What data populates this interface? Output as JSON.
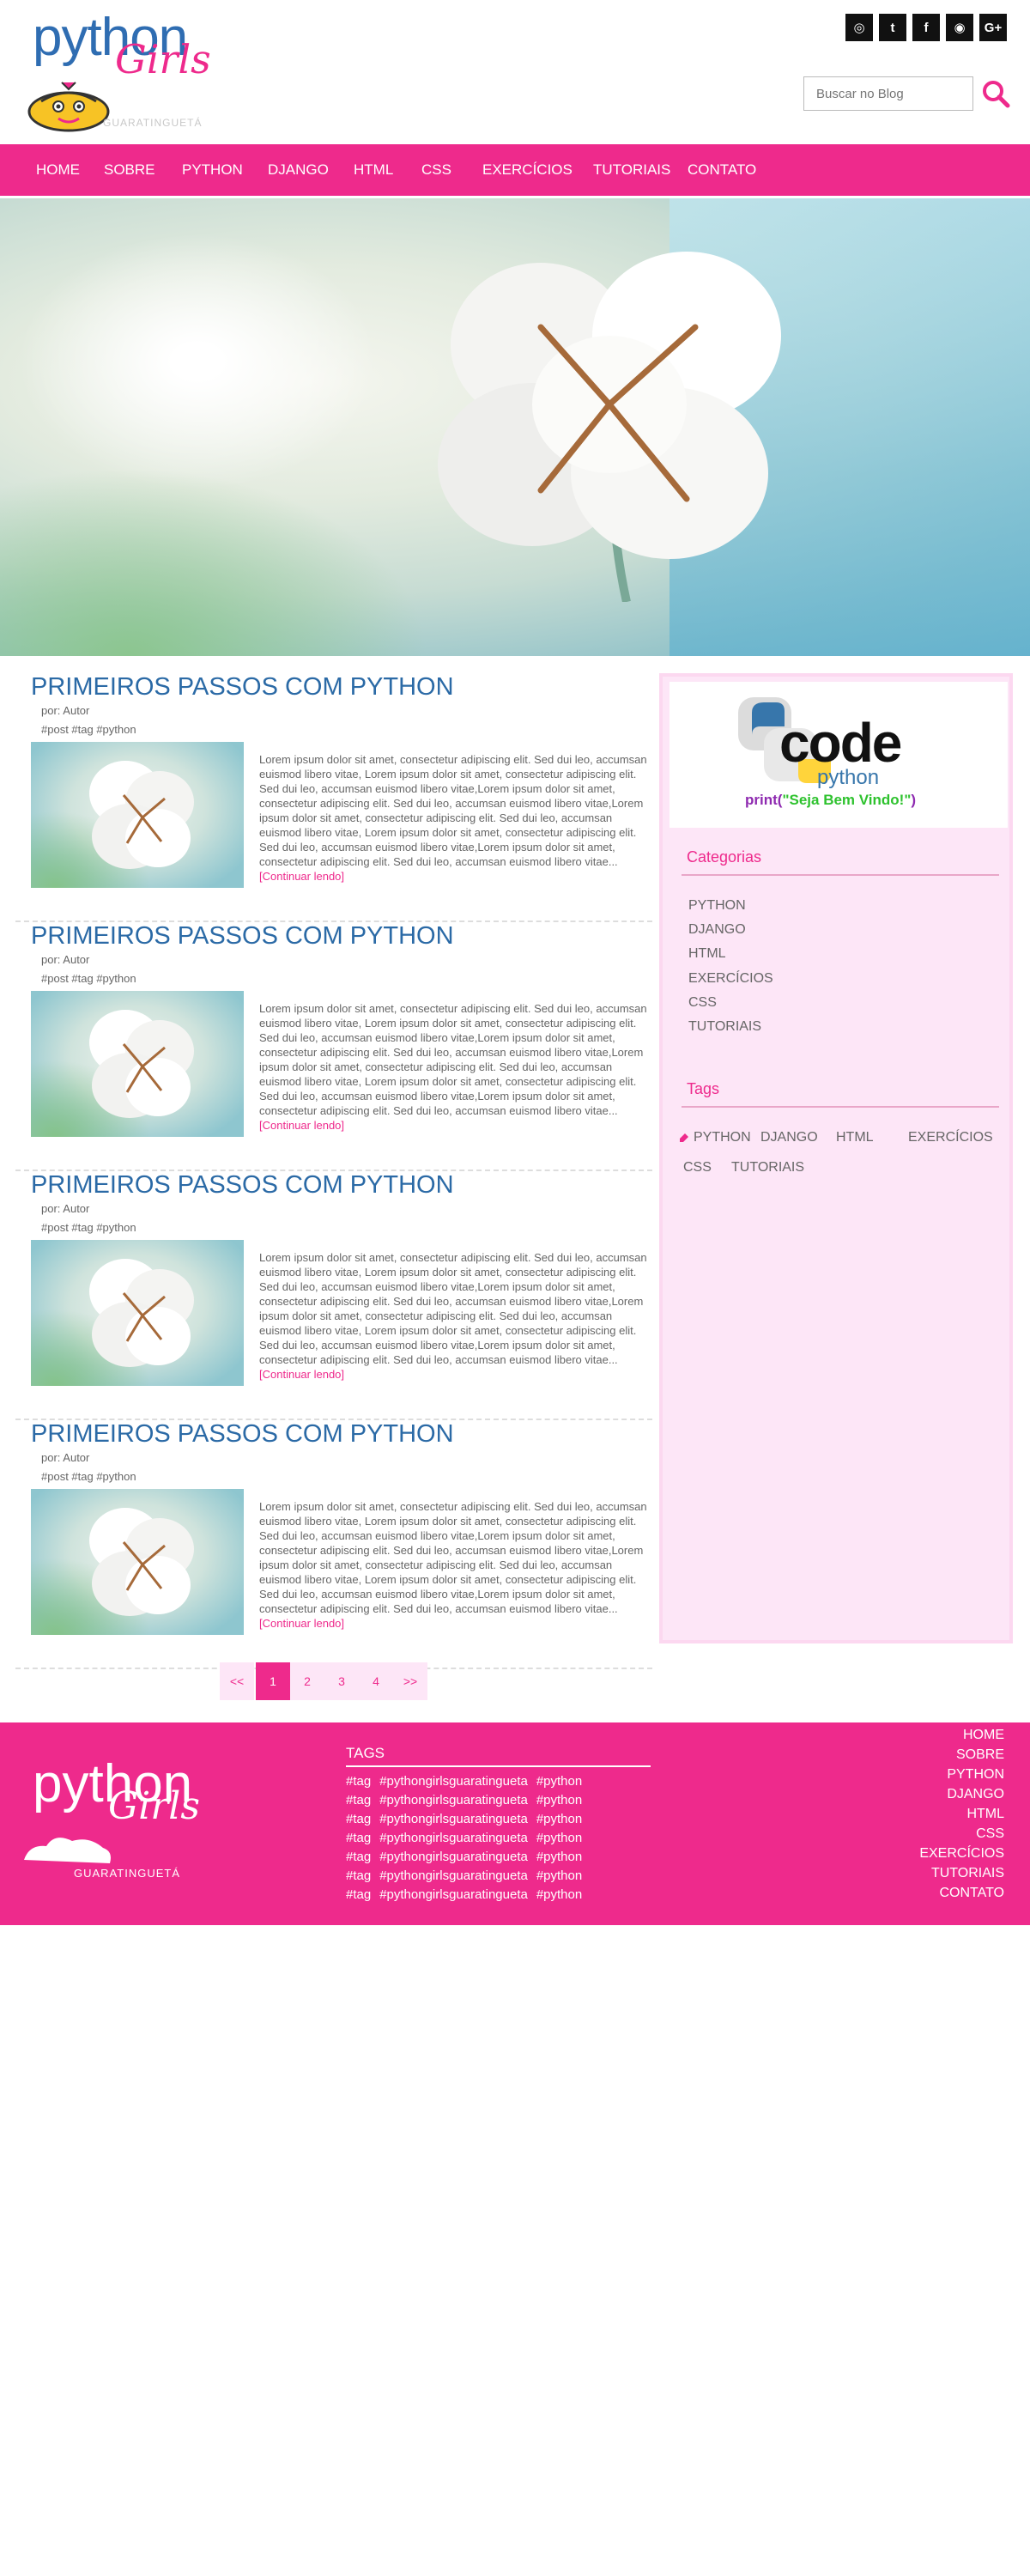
{
  "brand": {
    "logo_top": "python",
    "logo_script": "Girls",
    "logo_sub": "GUARATINGUETÁ"
  },
  "social": [
    {
      "icon": "instagram-icon",
      "glyph": "◎"
    },
    {
      "icon": "twitter-icon",
      "glyph": "t"
    },
    {
      "icon": "facebook-icon",
      "glyph": "f"
    },
    {
      "icon": "github-icon",
      "glyph": "◉"
    },
    {
      "icon": "google-plus-icon",
      "glyph": "G+"
    }
  ],
  "search": {
    "placeholder": "Buscar no Blog"
  },
  "nav": [
    "HOME",
    "SOBRE",
    "PYTHON",
    "DJANGO",
    "HTML",
    "CSS",
    "EXERCÍCIOS",
    "TUTORIAIS",
    "CONTATO"
  ],
  "posts": [
    {
      "title": "PRIMEIROS PASSOS COM PYTHON",
      "author": "por: Autor",
      "tags": "#post #tag #python",
      "excerpt": "Lorem ipsum dolor sit amet, consectetur adipiscing elit. Sed dui leo, accumsan euismod libero vitae, Lorem ipsum dolor sit amet, consectetur adipiscing elit. Sed dui leo, accumsan euismod libero vitae,Lorem ipsum dolor sit amet, consectetur adipiscing elit. Sed dui leo, accumsan euismod libero vitae,Lorem ipsum dolor sit amet, consectetur adipiscing elit. Sed dui leo, accumsan euismod libero vitae, Lorem ipsum dolor sit amet, consectetur adipiscing elit. Sed dui leo, accumsan euismod libero vitae,Lorem ipsum dolor sit amet, consectetur adipiscing elit. Sed dui leo, accumsan euismod libero vitae...",
      "more": "[Continuar lendo]"
    },
    {
      "title": "PRIMEIROS PASSOS COM PYTHON",
      "author": "por: Autor",
      "tags": "#post #tag #python",
      "excerpt": "Lorem ipsum dolor sit amet, consectetur adipiscing elit. Sed dui leo, accumsan euismod libero vitae, Lorem ipsum dolor sit amet, consectetur adipiscing elit. Sed dui leo, accumsan euismod libero vitae,Lorem ipsum dolor sit amet, consectetur adipiscing elit. Sed dui leo, accumsan euismod libero vitae,Lorem ipsum dolor sit amet, consectetur adipiscing elit. Sed dui leo, accumsan euismod libero vitae, Lorem ipsum dolor sit amet, consectetur adipiscing elit. Sed dui leo, accumsan euismod libero vitae,Lorem ipsum dolor sit amet, consectetur adipiscing elit. Sed dui leo, accumsan euismod libero vitae...",
      "more": "[Continuar lendo]"
    },
    {
      "title": "PRIMEIROS PASSOS COM PYTHON",
      "author": "por: Autor",
      "tags": "#post #tag #python",
      "excerpt": "Lorem ipsum dolor sit amet, consectetur adipiscing elit. Sed dui leo, accumsan euismod libero vitae, Lorem ipsum dolor sit amet, consectetur adipiscing elit. Sed dui leo, accumsan euismod libero vitae,Lorem ipsum dolor sit amet, consectetur adipiscing elit. Sed dui leo, accumsan euismod libero vitae,Lorem ipsum dolor sit amet, consectetur adipiscing elit. Sed dui leo, accumsan euismod libero vitae, Lorem ipsum dolor sit amet, consectetur adipiscing elit. Sed dui leo, accumsan euismod libero vitae,Lorem ipsum dolor sit amet, consectetur adipiscing elit. Sed dui leo, accumsan euismod libero vitae...",
      "more": "[Continuar lendo]"
    },
    {
      "title": "PRIMEIROS PASSOS COM PYTHON",
      "author": "por: Autor",
      "tags": "#post #tag #python",
      "excerpt": "Lorem ipsum dolor sit amet, consectetur adipiscing elit. Sed dui leo, accumsan euismod libero vitae, Lorem ipsum dolor sit amet, consectetur adipiscing elit. Sed dui leo, accumsan euismod libero vitae,Lorem ipsum dolor sit amet, consectetur adipiscing elit. Sed dui leo, accumsan euismod libero vitae,Lorem ipsum dolor sit amet, consectetur adipiscing elit. Sed dui leo, accumsan euismod libero vitae, Lorem ipsum dolor sit amet, consectetur adipiscing elit. Sed dui leo, accumsan euismod libero vitae,Lorem ipsum dolor sit amet, consectetur adipiscing elit. Sed dui leo, accumsan euismod libero vitae...",
      "more": "[Continuar lendo]"
    }
  ],
  "sidebar": {
    "code_word": "code",
    "code_python": "python",
    "code_print": "print(",
    "code_string": "\"Seja Bem Vindo!\"",
    "code_close": ")",
    "categories_title": "Categorias",
    "categories": [
      "PYTHON",
      "DJANGO",
      "HTML",
      "EXERCÍCIOS",
      "CSS",
      "TUTORIAIS"
    ],
    "tags_title": "Tags",
    "tags": [
      "PYTHON",
      "DJANGO",
      "HTML",
      "EXERCÍCIOS",
      "CSS",
      "TUTORIAIS"
    ]
  },
  "pagination": [
    "<<",
    "1",
    "2",
    "3",
    "4",
    ">>"
  ],
  "footer": {
    "logo_top": "python",
    "logo_script": "Girls",
    "logo_sub": "GUARATINGUETÁ",
    "tags_title": "TAGS",
    "tag_rows": [
      [
        "#tag",
        "#pythongirlsguaratingueta",
        "#python"
      ],
      [
        "#tag",
        "#pythongirlsguaratingueta",
        "#python"
      ],
      [
        "#tag",
        "#pythongirlsguaratingueta",
        "#python"
      ],
      [
        "#tag",
        "#pythongirlsguaratingueta",
        "#python"
      ],
      [
        "#tag",
        "#pythongirlsguaratingueta",
        "#python"
      ],
      [
        "#tag",
        "#pythongirlsguaratingueta",
        "#python"
      ],
      [
        "#tag",
        "#pythongirlsguaratingueta",
        "#python"
      ]
    ],
    "nav": [
      "HOME",
      "SOBRE",
      "PYTHON",
      "DJANGO",
      "HTML",
      "CSS",
      "EXERCÍCIOS",
      "TUTORIAIS",
      "CONTATO"
    ]
  },
  "colors": {
    "accent": "#ee2a8c",
    "title_blue": "#2b6aa6",
    "sidebar_bg": "#fde6f7"
  }
}
